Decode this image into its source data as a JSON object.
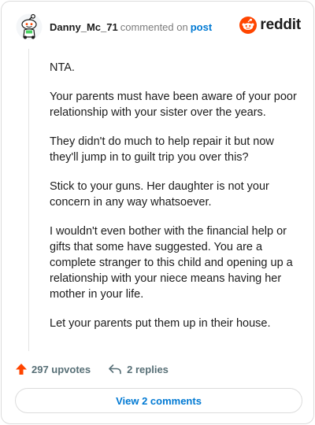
{
  "header": {
    "username": "Danny_Mc_71",
    "action": "commented on",
    "post_link": "post",
    "brand": "reddit"
  },
  "comment": {
    "paragraphs": [
      "NTA.",
      "Your parents must have been aware of your poor relationship with your sister over the years.",
      "They didn't do much to help repair it but now they'll jump in to guilt trip you over this?",
      "Stick to your guns. Her daughter is not your concern in any way whatsoever.",
      "I wouldn't even bother with the financial help or gifts that some have suggested. You are a complete stranger to this child and opening up a relationship with your niece means having her mother in your life.",
      "Let your parents put them up in their house."
    ]
  },
  "footer": {
    "upvotes": "297 upvotes",
    "replies": "2 replies",
    "view_comments": "View 2 comments"
  },
  "colors": {
    "accent": "#0079d3",
    "upvote": "#ff4500",
    "brand": "#ff4500",
    "muted": "#576f76"
  },
  "icons": {
    "avatar": "snoo-avatar-icon",
    "brand": "reddit-logo-icon",
    "upvote": "upvote-arrow-icon",
    "reply": "reply-arrow-icon"
  }
}
